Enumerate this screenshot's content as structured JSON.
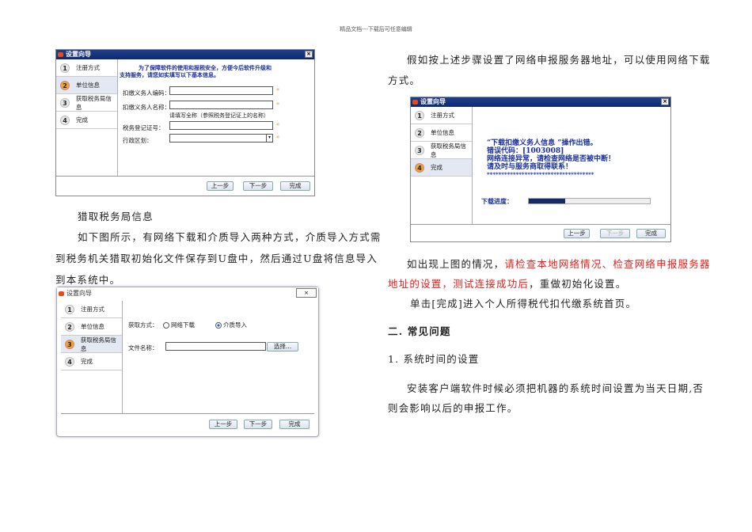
{
  "header": "精品文档---下载后可任意编辑",
  "wizard_title": "设置向导",
  "steps": [
    "注册方式",
    "单位信息",
    "获取税务局信息",
    "完成"
  ],
  "buttons": {
    "prev": "上一步",
    "next": "下一步",
    "finish": "完成",
    "choose": "选择..."
  },
  "dialog1": {
    "notice_line1": "为了保障软件的使用和报税安全，方便今后软件升级和",
    "notice_line2": "支持服务，请您如实填写以下基本信息。",
    "fields": [
      "扣缴义务人编码：",
      "扣缴义务人名称：",
      "税务登记证号：",
      "行政区划："
    ],
    "hint": "请填写全称（参照税务登记证上的名称）",
    "required": "*"
  },
  "heading_left": "猎取税务局信息",
  "para_left": [
    "如下图所示，有网络下载和介质导入两种方式，介质导入方式需",
    "到税务机关猎取初始化文件保存到U盘中，然后通过U盘将信息导入",
    "到本系统中。"
  ],
  "dialog2": {
    "method_label": "获取方式：",
    "option_network": "网络下载",
    "option_media": "介质导入",
    "selected": "介质导入",
    "file_label": "文件名称："
  },
  "para_right_top": [
    "假如按上述步骤设置了网络申报服务器地址，可以使用网络下载",
    "方式。"
  ],
  "dialog3": {
    "error_lines": [
      "“下载扣缴义务人信息 ”操作出错。",
      "错误代码：[1003008]",
      "网络连接异常，请检查网络是否被中断！",
      "请及时与服务商取得联系！",
      "*************************************"
    ],
    "progress_label": "下载进度：",
    "progress": 0.3
  },
  "para_right": {
    "line1_a": "如出现上图的情况，",
    "line1_red": "请检查本地网络情况、检查网络申报服务器",
    "line2_red": "地址的设置，测试连接成功后",
    "line2_b": "，重做初始化设置。",
    "line3": "单击[完成]进入个人所得税代扣代缴系统首页。"
  },
  "section": "二. 常见问题",
  "subsection": "1. 系统时间的设置",
  "para_time": [
    "安装客户端软件时候必须把机器的系统时间设置为当天日期,否",
    "则会影响以后的申报工作。"
  ]
}
